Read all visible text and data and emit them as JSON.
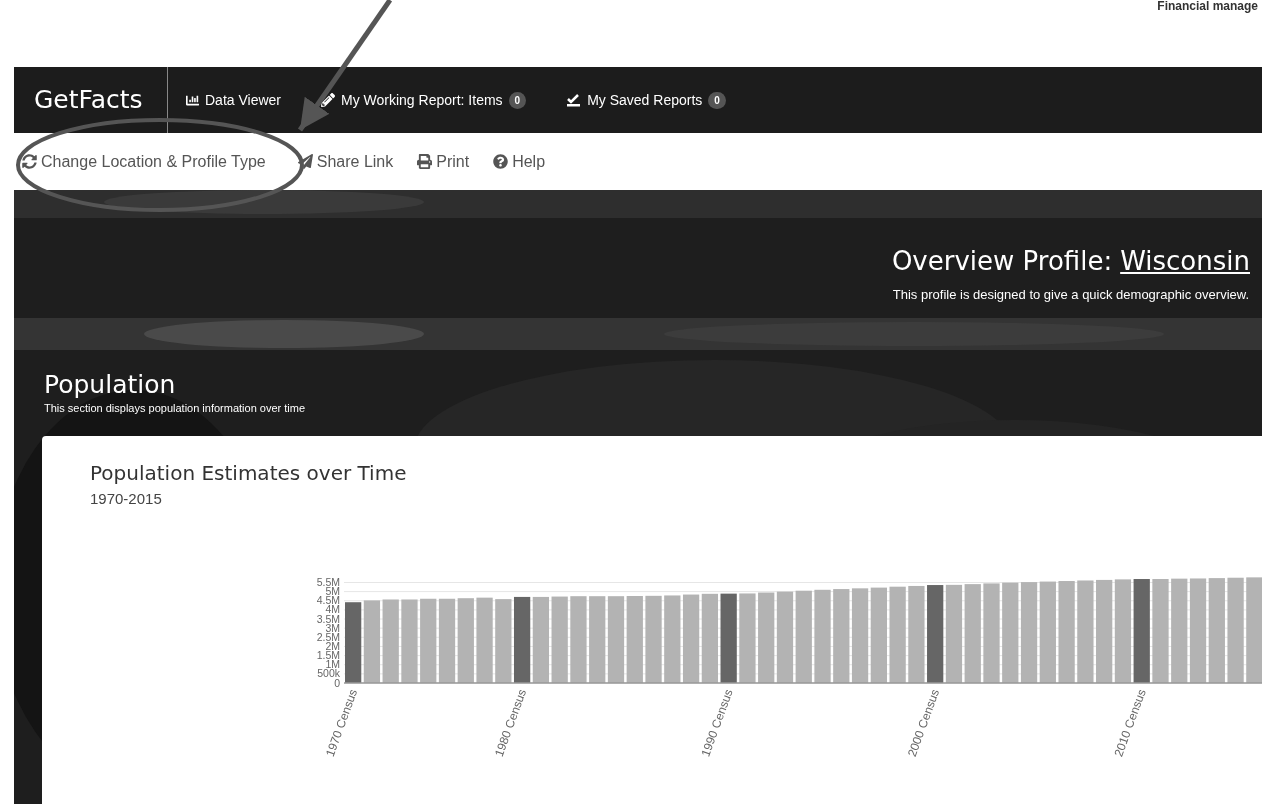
{
  "header_note": "Financial manage",
  "navbar": {
    "brand": "GetFacts",
    "items": [
      {
        "kind": "chart",
        "label": "Data Viewer"
      },
      {
        "kind": "pencil",
        "label": "My Working Report: Items",
        "badge": "0"
      },
      {
        "kind": "check",
        "label": "My Saved Reports",
        "badge": "0"
      }
    ]
  },
  "toolbar": [
    {
      "kind": "refresh",
      "label": "Change Location & Profile Type"
    },
    {
      "kind": "send",
      "label": "Share Link"
    },
    {
      "kind": "print",
      "label": "Print"
    },
    {
      "kind": "help",
      "label": "Help"
    }
  ],
  "profile": {
    "title": "Overview Profile:",
    "location": "Wisconsin",
    "subtitle": "This profile is designed to give a quick demographic overview."
  },
  "section": {
    "title": "Population",
    "subtitle": "This section displays population information over time"
  },
  "card": {
    "title": "Population Estimates over Time",
    "subtitle": "1970-2015",
    "chart_data": {
      "type": "bar",
      "stacked": true,
      "grid": true,
      "ylim": [
        0,
        5800000
      ],
      "yticks": [
        {
          "value": 0,
          "label": "0"
        },
        {
          "value": 500000,
          "label": "500k"
        },
        {
          "value": 1000000,
          "label": "1M"
        },
        {
          "value": 1500000,
          "label": "1.5M"
        },
        {
          "value": 2000000,
          "label": "2M"
        },
        {
          "value": 2500000,
          "label": "2.5M"
        },
        {
          "value": 3000000,
          "label": "3M"
        },
        {
          "value": 3500000,
          "label": "3.5M"
        },
        {
          "value": 4000000,
          "label": "4M"
        },
        {
          "value": 4500000,
          "label": "4.5M"
        },
        {
          "value": 5000000,
          "label": "5M"
        },
        {
          "value": 5500000,
          "label": "5.5M"
        }
      ],
      "categories": [
        "1970 Census",
        null,
        null,
        null,
        null,
        null,
        null,
        null,
        null,
        "1980 Census",
        null,
        null,
        null,
        null,
        null,
        null,
        null,
        null,
        null,
        null,
        "1990 Census",
        null,
        null,
        null,
        null,
        null,
        null,
        null,
        null,
        null,
        null,
        "2000 Census",
        null,
        null,
        null,
        null,
        null,
        null,
        null,
        null,
        null,
        null,
        "2010 Census",
        null,
        null,
        null,
        null,
        null,
        null
      ],
      "series": [
        {
          "color": "#666666",
          "values": [
            4420000,
            null,
            null,
            null,
            null,
            null,
            null,
            null,
            null,
            4710000,
            null,
            null,
            null,
            null,
            null,
            null,
            null,
            null,
            null,
            null,
            4890000,
            null,
            null,
            null,
            null,
            null,
            null,
            null,
            null,
            null,
            null,
            5360000,
            null,
            null,
            null,
            null,
            null,
            null,
            null,
            null,
            null,
            null,
            5690000,
            null,
            null,
            null,
            null,
            null,
            null
          ]
        },
        {
          "color": "#b3b3b3",
          "values": [
            null,
            4520000,
            4570000,
            4570000,
            4610000,
            4610000,
            4640000,
            4670000,
            4590000,
            null,
            4710000,
            4730000,
            4750000,
            4750000,
            4750000,
            4760000,
            4770000,
            4790000,
            4840000,
            4880000,
            null,
            4900000,
            4950000,
            5000000,
            5050000,
            5100000,
            5140000,
            5180000,
            5220000,
            5270000,
            5310000,
            null,
            5370000,
            5410000,
            5450000,
            5490000,
            5520000,
            5550000,
            5580000,
            5610000,
            5640000,
            5670000,
            null,
            5690000,
            5710000,
            5720000,
            5740000,
            5760000,
            5780000
          ]
        }
      ]
    }
  }
}
